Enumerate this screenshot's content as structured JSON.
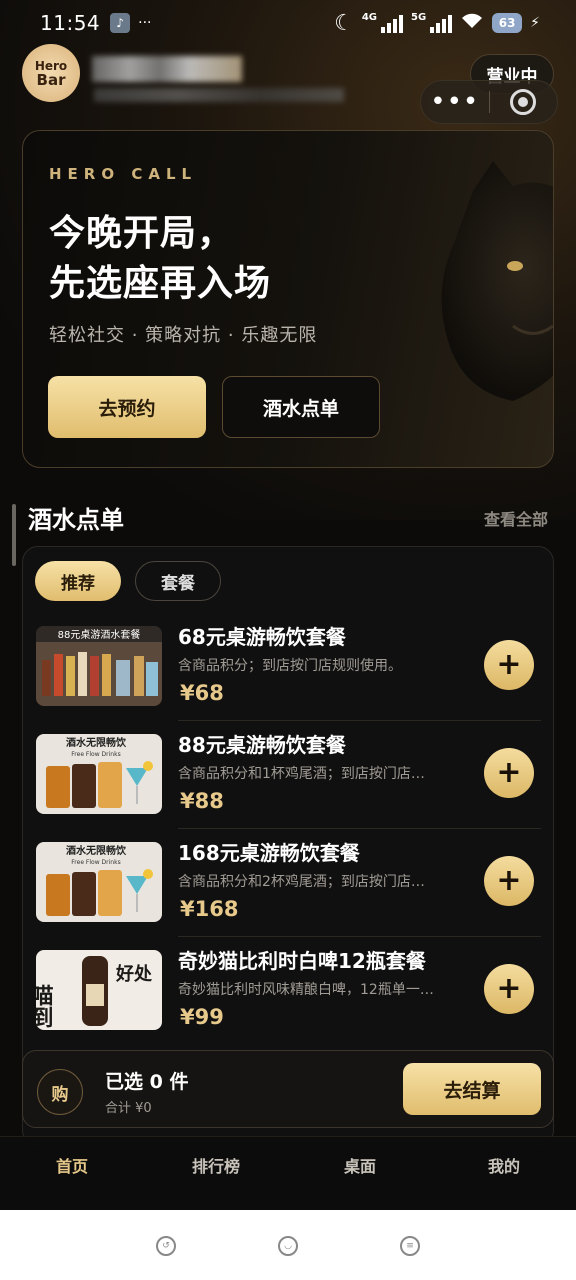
{
  "status_bar": {
    "time": "11:54",
    "dots": "···",
    "net1": "4G",
    "net2": "5G",
    "battery": "63"
  },
  "header": {
    "logo_line1": "Hero",
    "logo_line2": "Bar",
    "status_badge": "营业中"
  },
  "hero": {
    "eyebrow": "HERO CALL",
    "title_line1": "今晚开局，",
    "title_line2": "先选座再入场",
    "subtitle": "轻松社交 · 策略对抗 · 乐趣无限",
    "primary_button": "去预约",
    "secondary_button": "酒水点单"
  },
  "section": {
    "title": "酒水点单",
    "more": "查看全部"
  },
  "menu_tabs": {
    "recommend": "推荐",
    "combo": "套餐"
  },
  "items": [
    {
      "name": "68元桌游畅饮套餐",
      "desc": "含商品积分；到店按门店规则使用。",
      "price": "¥68",
      "thumb_text": "88元桌游酒水套餐"
    },
    {
      "name": "88元桌游畅饮套餐",
      "desc": "含商品积分和1杯鸡尾酒；到店按门店…",
      "price": "¥88",
      "thumb_text": "酒水无限畅饮",
      "thumb_sub": "Free Flow Drinks"
    },
    {
      "name": "168元桌游畅饮套餐",
      "desc": "含商品积分和2杯鸡尾酒；到店按门店…",
      "price": "¥168",
      "thumb_text": "酒水无限畅饮",
      "thumb_sub": "Free Flow Drinks"
    },
    {
      "name": "奇妙猫比利时白啤12瓶套餐",
      "desc": "奇妙猫比利时风味精酿白啤，12瓶单一…",
      "price": "¥99",
      "thumb_text": "喵到",
      "thumb_text2": "好处"
    }
  ],
  "cart": {
    "icon_label": "购",
    "count": "已选 0 件",
    "total": "合计 ¥0",
    "checkout": "去结算"
  },
  "tabbar": {
    "home": "首页",
    "ranking": "排行榜",
    "table": "桌面",
    "mine": "我的"
  },
  "colors": {
    "gold": "#e7c98b",
    "gold_button": "#e0bd6e",
    "background": "#0c0b0a"
  }
}
